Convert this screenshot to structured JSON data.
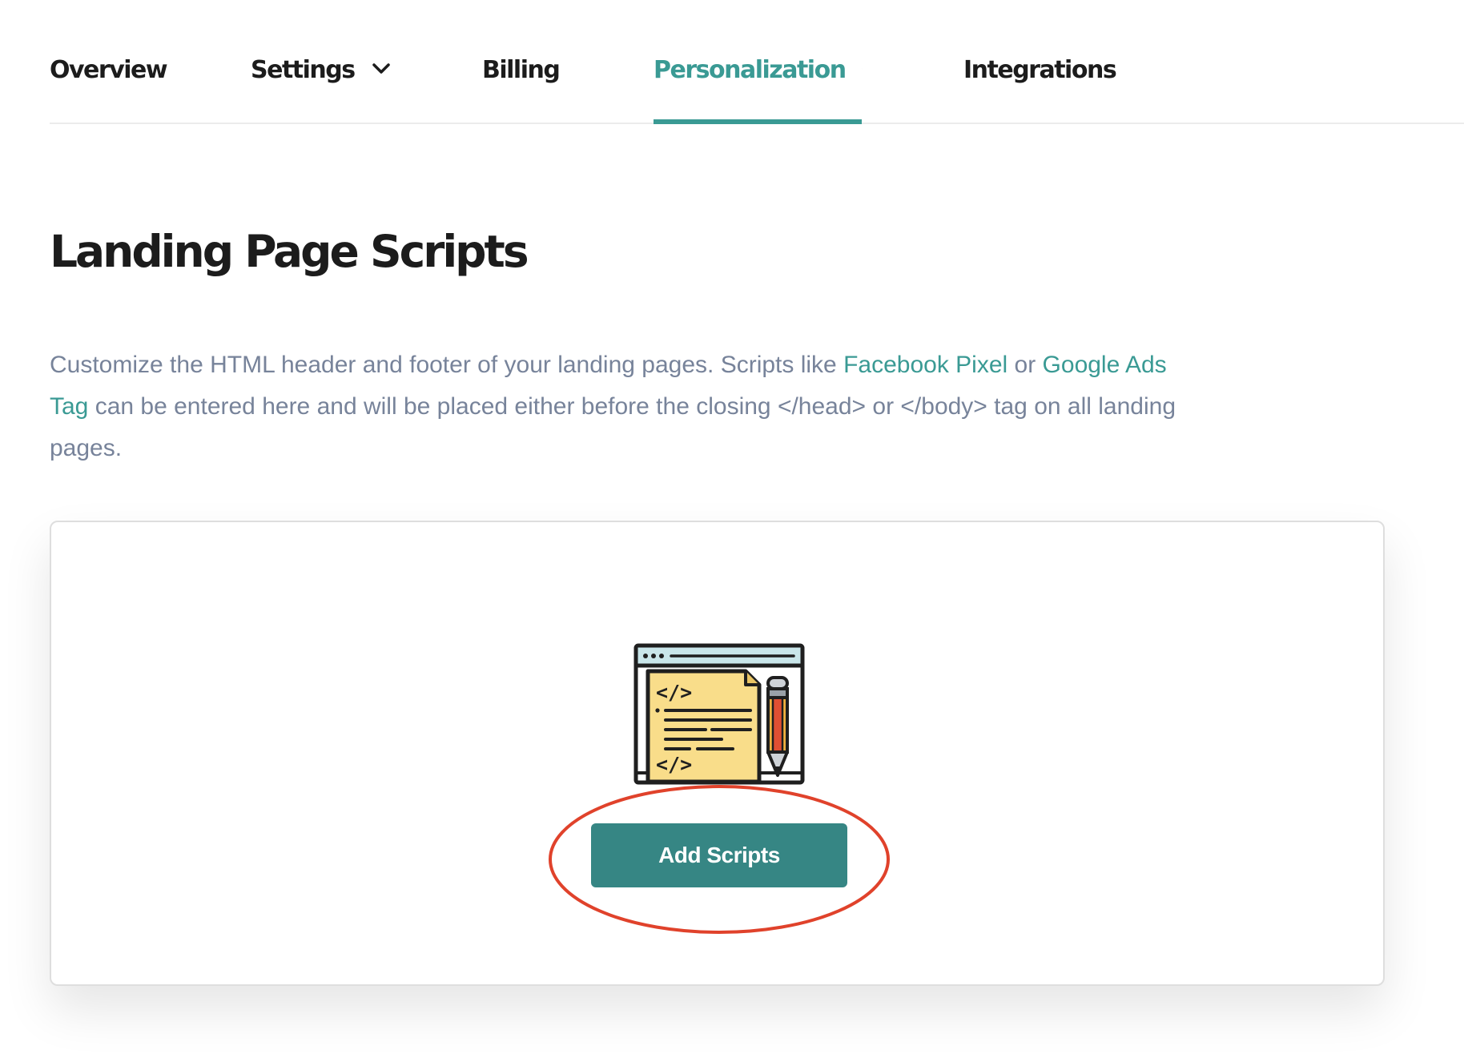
{
  "nav": {
    "tabs": [
      {
        "label": "Overview",
        "has_dropdown": false,
        "active": false
      },
      {
        "label": "Settings",
        "has_dropdown": true,
        "active": false
      },
      {
        "label": "Billing",
        "has_dropdown": false,
        "active": false
      },
      {
        "label": "Personalization",
        "has_dropdown": true,
        "active": true
      },
      {
        "label": "Integrations",
        "has_dropdown": false,
        "active": false
      }
    ]
  },
  "page": {
    "title": "Landing Page Scripts",
    "description": {
      "text_1": "Customize the HTML header and footer of your landing pages. Scripts like ",
      "link_1": "Facebook Pixel",
      "text_2": " or ",
      "link_2": "Google Ads Tag",
      "text_3": " can be entered here and will be placed either before the closing </head> or </body> tag on all landing pages."
    }
  },
  "empty_state": {
    "illustration": "code-document-pencil-icon",
    "illustration_code_tags": [
      "</>",
      "</>"
    ],
    "button_label": "Add Scripts"
  },
  "colors": {
    "accent": "#3a9a94",
    "button": "#368684",
    "heading": "#1c1c1c",
    "body_text": "#77839a",
    "annotation": "#e0422b"
  }
}
